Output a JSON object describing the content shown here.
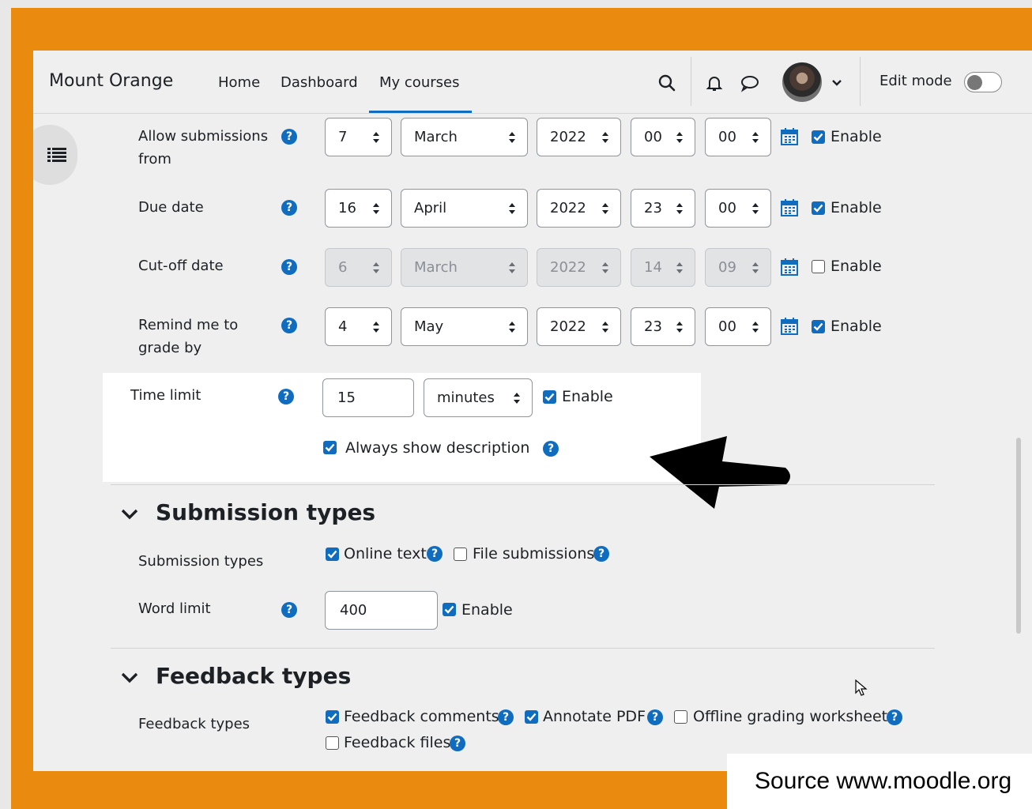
{
  "navbar": {
    "brand": "Mount Orange",
    "links": [
      "Home",
      "Dashboard",
      "My courses"
    ],
    "active_link": "My courses",
    "edit_mode_label": "Edit mode",
    "edit_mode_on": false
  },
  "form": {
    "allow_submissions": {
      "label": "Allow submissions from",
      "day": "7",
      "month": "March",
      "year": "2022",
      "hour": "00",
      "minute": "00",
      "enable_label": "Enable",
      "enabled": true
    },
    "due_date": {
      "label": "Due date",
      "day": "16",
      "month": "April",
      "year": "2022",
      "hour": "23",
      "minute": "00",
      "enable_label": "Enable",
      "enabled": true
    },
    "cutoff_date": {
      "label": "Cut-off date",
      "day": "6",
      "month": "March",
      "year": "2022",
      "hour": "14",
      "minute": "09",
      "enable_label": "Enable",
      "enabled": false
    },
    "remind_grade": {
      "label": "Remind me to grade by",
      "day": "4",
      "month": "May",
      "year": "2022",
      "hour": "23",
      "minute": "00",
      "enable_label": "Enable",
      "enabled": true
    },
    "time_limit": {
      "label": "Time limit",
      "value": "15",
      "unit": "minutes",
      "enable_label": "Enable",
      "enabled": true
    },
    "always_show_description": {
      "label": "Always show description",
      "checked": true
    }
  },
  "submission_types": {
    "heading": "Submission types",
    "row_label": "Submission types",
    "online_text": "Online text",
    "online_text_checked": true,
    "file_submissions": "File submissions",
    "file_submissions_checked": false,
    "word_limit_label": "Word limit",
    "word_limit_value": "400",
    "word_limit_enable": "Enable",
    "word_limit_enabled": true
  },
  "feedback_types": {
    "heading": "Feedback types",
    "row_label": "Feedback types",
    "comments": "Feedback comments",
    "comments_checked": true,
    "annotate_pdf": "Annotate PDF",
    "annotate_pdf_checked": true,
    "offline_worksheet": "Offline grading worksheet",
    "offline_worksheet_checked": false,
    "files": "Feedback files",
    "files_checked": false
  },
  "source_caption": "Source www.moodle.org",
  "colors": {
    "frame": "#ea8a0e",
    "brand_blue": "#0f6cbf",
    "page_bg": "#efefef"
  }
}
